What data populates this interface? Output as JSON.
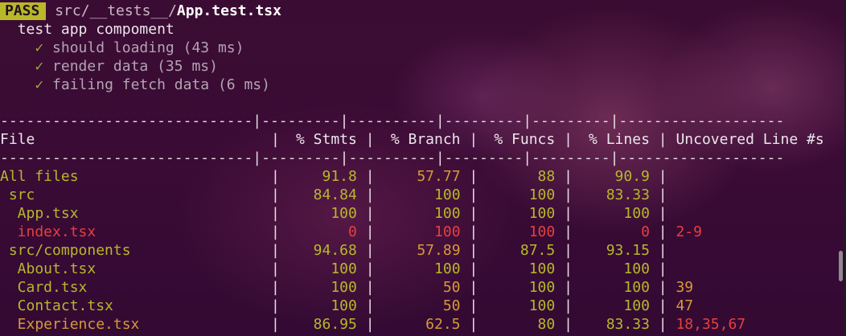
{
  "header": {
    "badge": "PASS",
    "path_dim": "src/__tests__/",
    "path_bold": "App.test.tsx"
  },
  "suite": {
    "name": "test app compoment",
    "tests": [
      {
        "check": "✓",
        "label": "should loading (43 ms)"
      },
      {
        "check": "✓",
        "label": "render data (35 ms)"
      },
      {
        "check": "✓",
        "label": "failing fetch data (6 ms)"
      }
    ]
  },
  "coverage": {
    "divider_top": "-----------------------------|---------|----------|---------|---------|-------------------",
    "divider_mid": "-----------------------------|---------|----------|---------|---------|-------------------",
    "sep": "|",
    "headers": [
      "File",
      "% Stmts",
      "% Branch",
      "% Funcs",
      "% Lines",
      "Uncovered Line #s"
    ],
    "rows": [
      {
        "file": "All files",
        "stmts": "91.8",
        "branch": "57.77",
        "funcs": "88",
        "lines": "90.9",
        "uncovered": ""
      },
      {
        "file": " src",
        "stmts": "84.84",
        "branch": "100",
        "funcs": "100",
        "lines": "83.33",
        "uncovered": ""
      },
      {
        "file": "  App.tsx",
        "stmts": "100",
        "branch": "100",
        "funcs": "100",
        "lines": "100",
        "uncovered": ""
      },
      {
        "file": "  index.tsx",
        "stmts": "0",
        "branch": "100",
        "funcs": "100",
        "lines": "0",
        "uncovered": "2-9"
      },
      {
        "file": " src/components",
        "stmts": "94.68",
        "branch": "57.89",
        "funcs": "87.5",
        "lines": "93.15",
        "uncovered": ""
      },
      {
        "file": "  About.tsx",
        "stmts": "100",
        "branch": "100",
        "funcs": "100",
        "lines": "100",
        "uncovered": ""
      },
      {
        "file": "  Card.tsx",
        "stmts": "100",
        "branch": "50",
        "funcs": "100",
        "lines": "100",
        "uncovered": "39"
      },
      {
        "file": "  Contact.tsx",
        "stmts": "100",
        "branch": "50",
        "funcs": "100",
        "lines": "100",
        "uncovered": "47"
      },
      {
        "file": "  Experience.tsx",
        "stmts": "86.95",
        "branch": "62.5",
        "funcs": "80",
        "lines": "83.33",
        "uncovered": "18,35,67"
      }
    ]
  },
  "colors": {
    "background": "#3a0b35",
    "pass_badge": "#b8b82a",
    "olive": "#b7b72c",
    "orange": "#d59a3a",
    "red": "#e4413e"
  }
}
